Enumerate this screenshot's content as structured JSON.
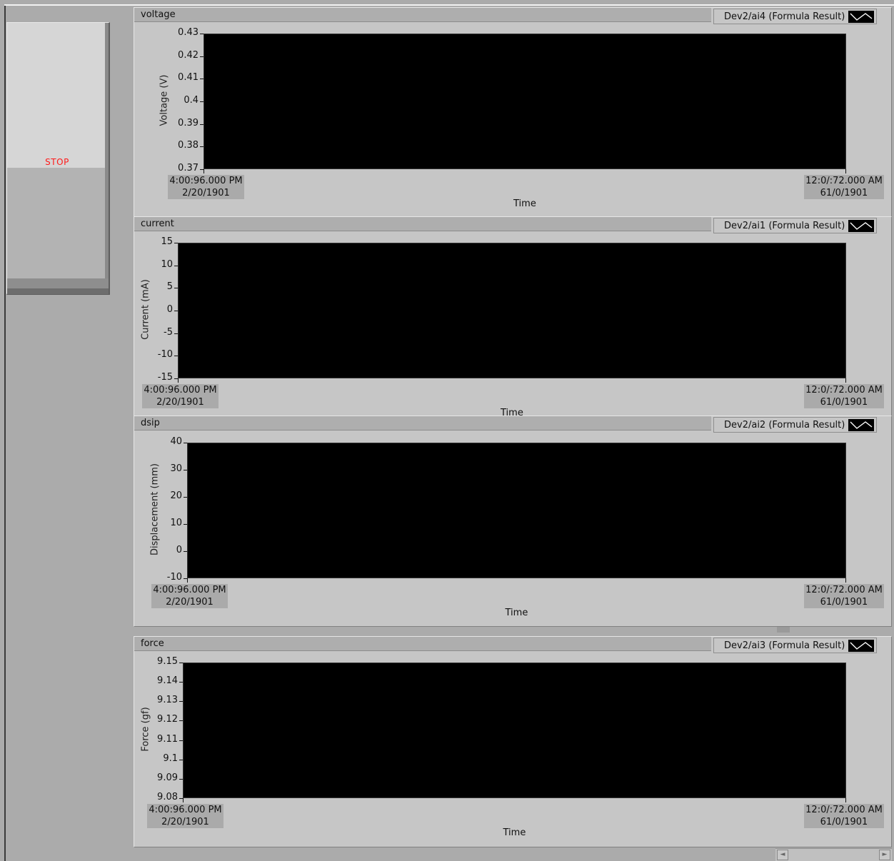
{
  "stop_button": {
    "label": "STOP"
  },
  "charts": [
    {
      "title": "voltage",
      "legend": "Dev2/ai4 (Formula Result)",
      "ylabel": "Voltage (V)",
      "yticks": [
        "0.43",
        "0.42",
        "0.41",
        "0.4",
        "0.39",
        "0.38",
        "0.37"
      ],
      "x_start": [
        "4:00:96.000 PM",
        "2/20/1901"
      ],
      "x_end": [
        "12:0/:72.000 AM",
        "61/0/1901"
      ],
      "xlabel": "Time"
    },
    {
      "title": "current",
      "legend": "Dev2/ai1 (Formula Result)",
      "ylabel": "Current (mA)",
      "yticks": [
        "15",
        "10",
        "5",
        "0",
        "-5",
        "-10",
        "-15"
      ],
      "x_start": [
        "4:00:96.000 PM",
        "2/20/1901"
      ],
      "x_end": [
        "12:0/:72.000 AM",
        "61/0/1901"
      ],
      "xlabel": "Time"
    },
    {
      "title": "dsip",
      "legend": "Dev2/ai2 (Formula Result)",
      "ylabel": "Displacement (mm)",
      "yticks": [
        "40",
        "30",
        "20",
        "10",
        "0",
        "-10"
      ],
      "x_start": [
        "4:00:96.000 PM",
        "2/20/1901"
      ],
      "x_end": [
        "12:0/:72.000 AM",
        "61/0/1901"
      ],
      "xlabel": "Time"
    },
    {
      "title": "force",
      "legend": "Dev2/ai3 (Formula Result)",
      "ylabel": "Force (gf)",
      "yticks": [
        "9.15",
        "9.14",
        "9.13",
        "9.12",
        "9.11",
        "9.1",
        "9.09",
        "9.08"
      ],
      "x_start": [
        "4:00:96.000 PM",
        "2/20/1901"
      ],
      "x_end": [
        "12:0/:72.000 AM",
        "61/0/1901"
      ],
      "xlabel": "Time"
    }
  ],
  "scrollbar": {
    "left_arrow": "◄",
    "right_arrow": "►"
  },
  "colors": {
    "stop_text": "#ff1a1a",
    "plot_bg": "#000000",
    "panel_bg": "#c6c6c6"
  }
}
